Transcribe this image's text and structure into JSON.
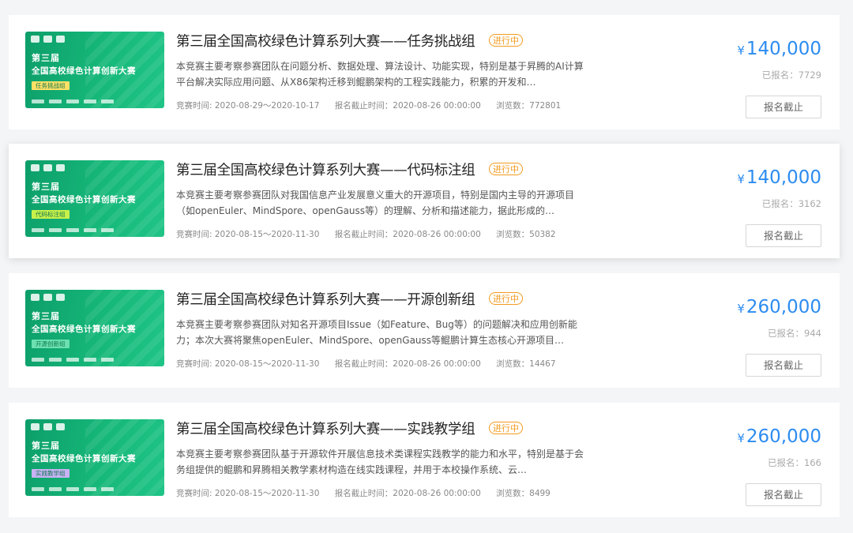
{
  "competitions": [
    {
      "banner": {
        "line1": "第三届",
        "line2": "全国高校绿色计算创新大赛",
        "tag": "任务挑战组",
        "tag_color": "#ffe066"
      },
      "title": "第三届全国高校绿色计算系列大赛——任务挑战组",
      "status": "进行中",
      "description": "本竞赛主要考察参赛团队在问题分析、数据处理、算法设计、功能实现，特别是基于昇腾的AI计算平台解决实际应用问题、从X86架构迁移到鲲鹏架构的工程实践能力，积累的开发和…",
      "time": "竞赛时间: 2020-08-29～2020-10-17",
      "deadline": "报名截止时间：2020-08-26 00:00:00",
      "views": "浏览数：772801",
      "currency": "¥",
      "prize": "140,000",
      "signed": "已报名：7729",
      "button": "报名截止"
    },
    {
      "banner": {
        "line1": "第三届",
        "line2": "全国高校绿色计算创新大赛",
        "tag": "代码标注组",
        "tag_color": "#c8f04a"
      },
      "title": "第三届全国高校绿色计算系列大赛——代码标注组",
      "status": "进行中",
      "description": "本竞赛主要考察参赛团队对我国信息产业发展意义重大的开源项目，特别是国内主导的开源项目（如openEuler、MindSpore、openGauss等）的理解、分析和描述能力，据此形成的…",
      "time": "竞赛时间: 2020-08-15～2020-11-30",
      "deadline": "报名截止时间：2020-08-26 00:00:00",
      "views": "浏览数：50382",
      "currency": "¥",
      "prize": "140,000",
      "signed": "已报名：3162",
      "button": "报名截止"
    },
    {
      "banner": {
        "line1": "第三届",
        "line2": "全国高校绿色计算创新大赛",
        "tag": "开源创新组",
        "tag_color": "#6ce0b0"
      },
      "title": "第三届全国高校绿色计算系列大赛——开源创新组",
      "status": "进行中",
      "description": "本竞赛主要考察参赛团队对知名开源项目Issue（如Feature、Bug等）的问题解决和应用创新能力；本次大赛将聚焦openEuler、MindSpore、openGauss等鲲鹏计算生态核心开源项目…",
      "time": "竞赛时间: 2020-08-15～2020-11-30",
      "deadline": "报名截止时间：2020-08-26 00:00:00",
      "views": "浏览数：14467",
      "currency": "¥",
      "prize": "260,000",
      "signed": "已报名：944",
      "button": "报名截止"
    },
    {
      "banner": {
        "line1": "第三届",
        "line2": "全国高校绿色计算创新大赛",
        "tag": "实践教学组",
        "tag_color": "#c9b2f5"
      },
      "title": "第三届全国高校绿色计算系列大赛——实践教学组",
      "status": "进行中",
      "description": "本竞赛主要考察参赛团队基于开源软件开展信息技术类课程实践教学的能力和水平，特别是基于会务组提供的鲲鹏和昇腾相关教学素材构造在线实践课程，并用于本校操作系统、云…",
      "time": "竞赛时间: 2020-08-15～2020-11-30",
      "deadline": "报名截止时间：2020-08-26 00:00:00",
      "views": "浏览数：8499",
      "currency": "¥",
      "prize": "260,000",
      "signed": "已报名：166",
      "button": "报名截止"
    }
  ]
}
